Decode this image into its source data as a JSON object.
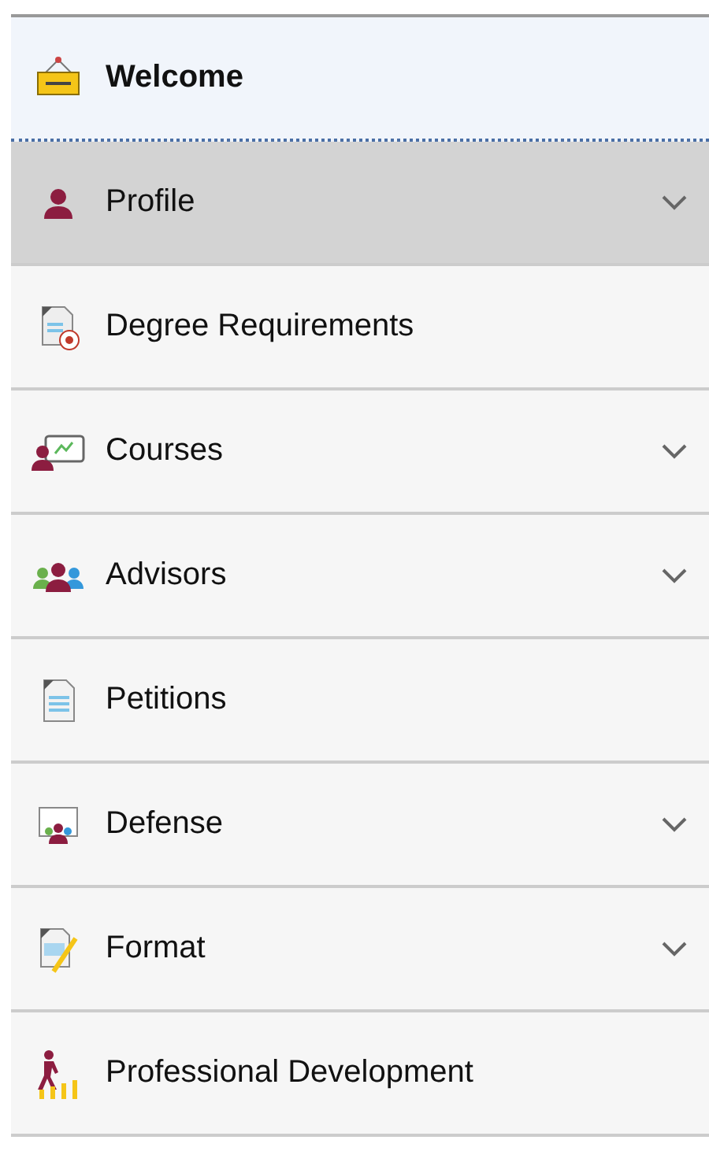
{
  "menu": {
    "items": [
      {
        "label": "Welcome",
        "kind": "header",
        "selected": false,
        "expandable": false
      },
      {
        "label": "Profile",
        "kind": "item",
        "selected": true,
        "expandable": true
      },
      {
        "label": "Degree Requirements",
        "kind": "item",
        "selected": false,
        "expandable": false
      },
      {
        "label": "Courses",
        "kind": "item",
        "selected": false,
        "expandable": true
      },
      {
        "label": "Advisors",
        "kind": "item",
        "selected": false,
        "expandable": true
      },
      {
        "label": "Petitions",
        "kind": "item",
        "selected": false,
        "expandable": false
      },
      {
        "label": "Defense",
        "kind": "item",
        "selected": false,
        "expandable": true
      },
      {
        "label": "Format",
        "kind": "item",
        "selected": false,
        "expandable": true
      },
      {
        "label": "Professional Development",
        "kind": "item",
        "selected": false,
        "expandable": false
      }
    ]
  }
}
